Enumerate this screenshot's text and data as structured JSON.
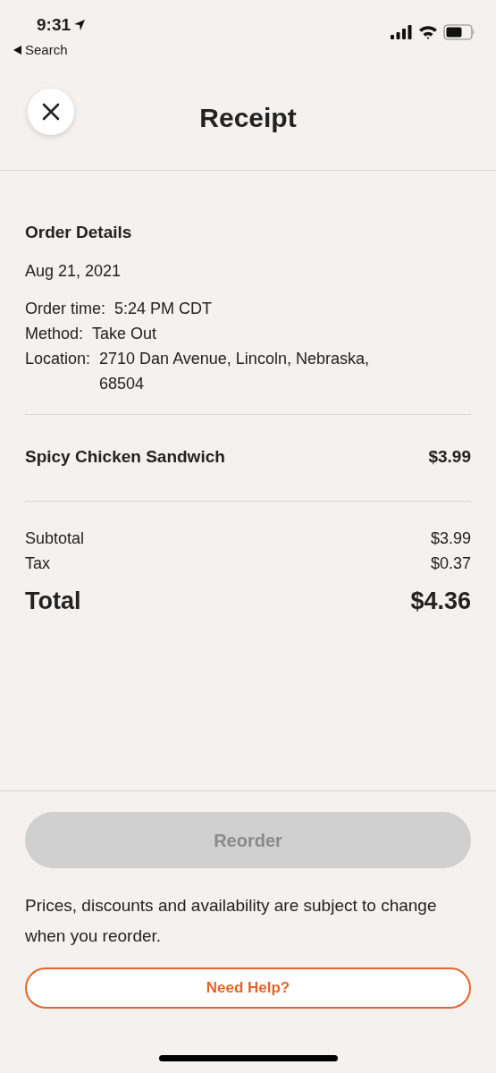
{
  "status_bar": {
    "time": "9:31",
    "back_label": "Search"
  },
  "header": {
    "title": "Receipt"
  },
  "order_details": {
    "heading": "Order Details",
    "date": "Aug 21, 2021",
    "fields": [
      {
        "label": "Order time:",
        "value": "5:24 PM CDT"
      },
      {
        "label": "Method:",
        "value": "Take Out"
      },
      {
        "label": "Location:",
        "value": "2710 Dan Avenue, Lincoln, Nebraska, 68504"
      }
    ]
  },
  "items": [
    {
      "name": "Spicy Chicken Sandwich",
      "price": "$3.99"
    }
  ],
  "summary": [
    {
      "label": "Subtotal",
      "value": "$3.99",
      "kind": "line"
    },
    {
      "label": "Tax",
      "value": "$0.37",
      "kind": "line"
    },
    {
      "label": "Total",
      "value": "$4.36",
      "kind": "total"
    }
  ],
  "footer": {
    "reorder": {
      "label": "Reorder",
      "disabled": true
    },
    "notice": "Prices, discounts and availability are subject to change when you reorder.",
    "help": "Need Help?"
  }
}
